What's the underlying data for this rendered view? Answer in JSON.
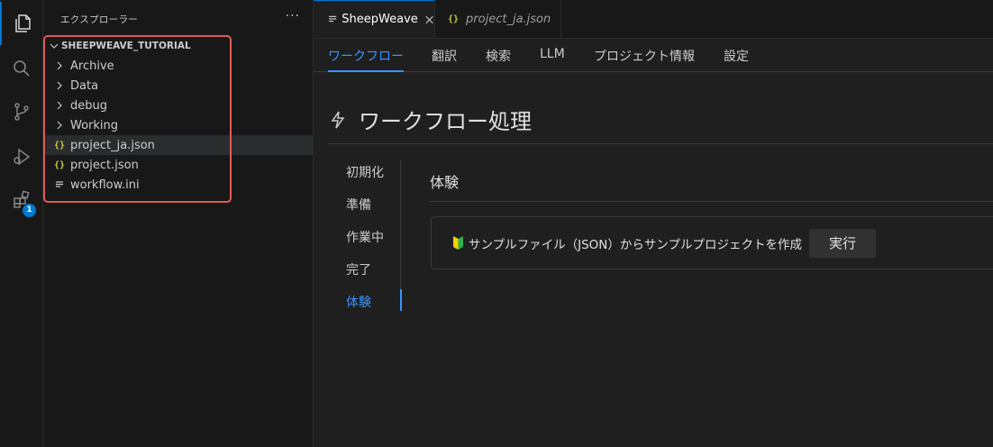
{
  "activity": {
    "extensions_badge": "1"
  },
  "sidebar": {
    "title": "エクスプローラー",
    "more": "···",
    "root": "SHEEPWEAVE_TUTORIAL",
    "items": [
      {
        "label": "Archive",
        "kind": "folder"
      },
      {
        "label": "Data",
        "kind": "folder"
      },
      {
        "label": "debug",
        "kind": "folder"
      },
      {
        "label": "Working",
        "kind": "folder"
      },
      {
        "label": "project_ja.json",
        "kind": "json",
        "selected": true
      },
      {
        "label": "project.json",
        "kind": "json"
      },
      {
        "label": "workflow.ini",
        "kind": "ini"
      }
    ],
    "json_icon_glyph": "{}"
  },
  "tabs": [
    {
      "label": "SheepWeave",
      "active": true
    },
    {
      "label": "project_ja.json",
      "active": false,
      "preview": true
    }
  ],
  "nav": {
    "items": [
      "ワークフロー",
      "翻訳",
      "検索",
      "LLM",
      "プロジェクト情報",
      "設定"
    ],
    "active_index": 0
  },
  "page": {
    "title": "ワークフロー処理"
  },
  "subnav": {
    "items": [
      "初期化",
      "準備",
      "作業中",
      "完了",
      "体験"
    ],
    "active_index": 4
  },
  "section": {
    "title": "体験",
    "card_text": "サンプルファイル（JSON）からサンプルプロジェクトを作成",
    "run_button": "実行"
  },
  "colors": {
    "accent": "#3794ff",
    "highlight_border": "#e05a58",
    "json_icon": "#cbcb41",
    "badge": "#0078d4"
  }
}
